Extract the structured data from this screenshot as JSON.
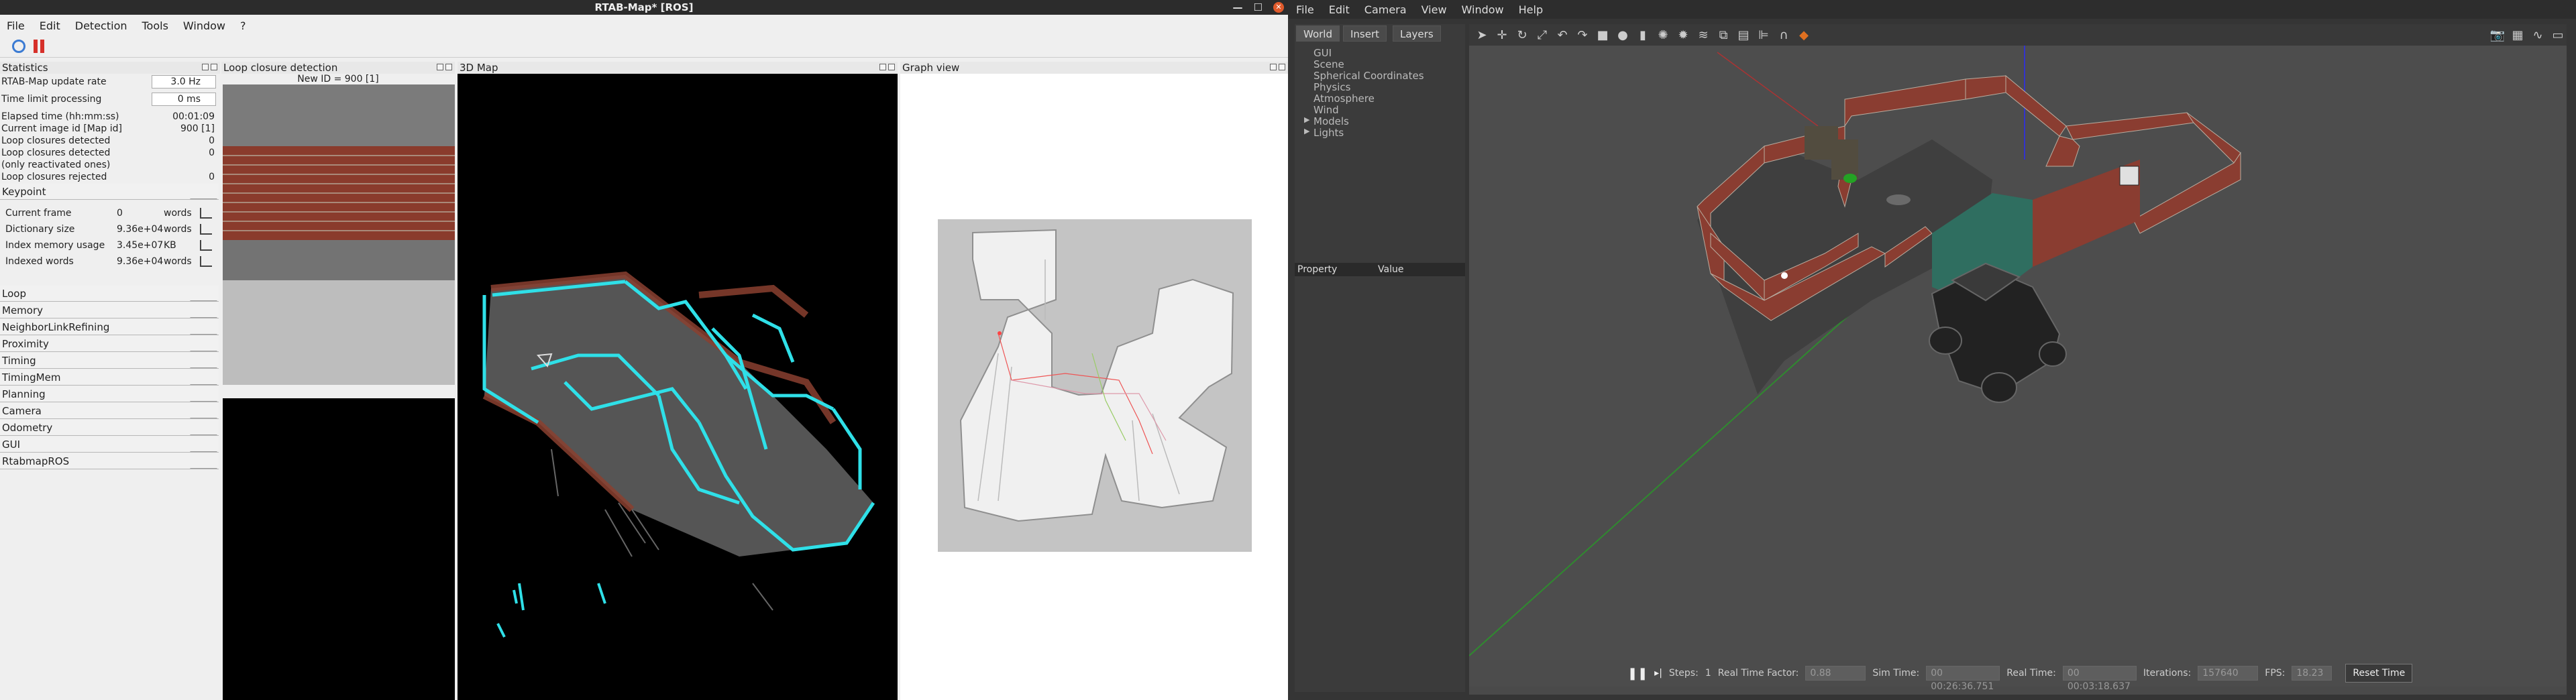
{
  "rtabmap": {
    "title": "RTAB-Map* [ROS]",
    "menu": [
      "File",
      "Edit",
      "Detection",
      "Tools",
      "Window",
      "?"
    ],
    "statistics": {
      "title": "Statistics",
      "update_rate_label": "RTAB-Map update rate",
      "update_rate_value": "3.0 Hz",
      "time_limit_label": "Time limit processing",
      "time_limit_value": "0 ms",
      "rows": [
        {
          "label": "Elapsed time (hh:mm:ss)",
          "value": "00:01:09"
        },
        {
          "label": "Current image id [Map id]",
          "value": "900 [1]"
        },
        {
          "label": "Loop closures detected",
          "value": "0"
        },
        {
          "label": "Loop closures detected",
          "value": "0"
        },
        {
          "label": "(only reactivated ones)",
          "value": ""
        },
        {
          "label": "Loop closures rejected",
          "value": "0"
        }
      ],
      "keypoint_section": "Keypoint",
      "keypoint_rows": [
        {
          "label": "Current frame",
          "value": "0",
          "unit": "words"
        },
        {
          "label": "Dictionary size",
          "value": "9.36e+04",
          "unit": "words"
        },
        {
          "label": "Index memory usage",
          "value": "3.45e+07",
          "unit": "KB"
        },
        {
          "label": "Indexed words",
          "value": "9.36e+04",
          "unit": "words"
        }
      ],
      "sections": [
        "Loop",
        "Memory",
        "NeighborLinkRefining",
        "Proximity",
        "Timing",
        "TimingMem",
        "Planning",
        "Camera",
        "Odometry",
        "GUI",
        "RtabmapROS"
      ]
    },
    "loop_panel": {
      "title": "Loop closure detection",
      "new_id": "New ID = 900 [1]"
    },
    "map3d_title": "3D Map",
    "graph_title": "Graph view"
  },
  "gazebo": {
    "menu": [
      "File",
      "Edit",
      "Camera",
      "View",
      "Window",
      "Help"
    ],
    "tabs": [
      "World",
      "Insert",
      "Layers"
    ],
    "tree": [
      "GUI",
      "Scene",
      "Spherical Coordinates",
      "Physics",
      "Atmosphere",
      "Wind",
      "Models",
      "Lights"
    ],
    "prop_header": {
      "property": "Property",
      "value": "Value"
    },
    "bottom": {
      "steps_label": "Steps:",
      "steps_value": "1",
      "rtf_label": "Real Time Factor:",
      "rtf_value": "0.88",
      "sim_label": "Sim Time:",
      "sim_value": "00 00:26:36.751",
      "real_label": "Real Time:",
      "real_value": "00 00:03:18.637",
      "iter_label": "Iterations:",
      "iter_value": "157640",
      "fps_label": "FPS:",
      "fps_value": "18.23",
      "reset": "Reset Time"
    }
  }
}
